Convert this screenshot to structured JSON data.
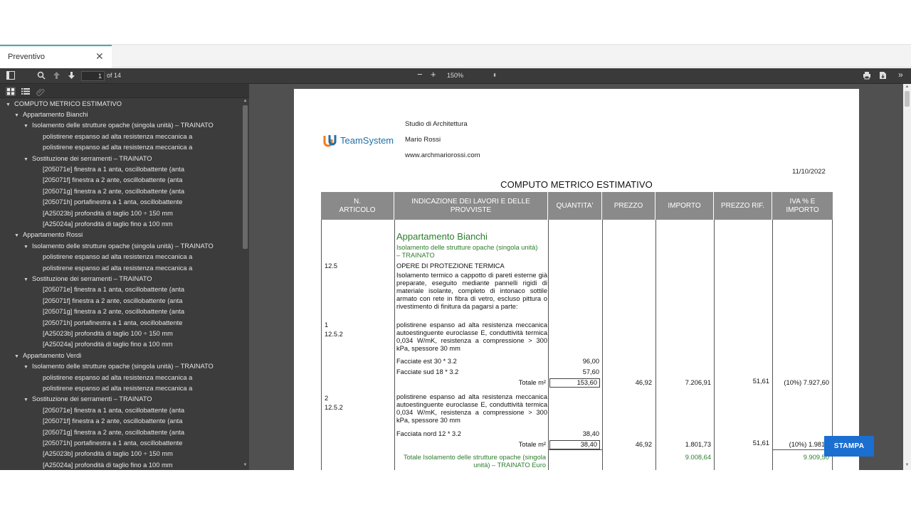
{
  "tab": {
    "label": "Preventivo",
    "close": "✕"
  },
  "toolbar": {
    "page_current": "1",
    "page_of": "of 14",
    "zoom_minus": "−",
    "zoom_plus": "+",
    "zoom_value": "150%"
  },
  "outline": {
    "root": "COMPUTO METRICO ESTIMATIVO",
    "rows": [
      {
        "level": 1,
        "toggle": "▼",
        "label": "Appartamento Bianchi"
      },
      {
        "level": 2,
        "toggle": "▼",
        "label": "Isolamento delle strutture opache (singola unità) – TRAINATO"
      },
      {
        "level": 3,
        "toggle": "",
        "label": "polistirene espanso ad alta resistenza meccanica a"
      },
      {
        "level": 3,
        "toggle": "",
        "label": "polistirene espanso ad alta resistenza meccanica a"
      },
      {
        "level": 2,
        "toggle": "▼",
        "label": "Sostituzione dei serramenti – TRAINATO"
      },
      {
        "level": 3,
        "toggle": "",
        "label": "[205071e] finestra a 1 anta, oscillobattente (anta"
      },
      {
        "level": 3,
        "toggle": "",
        "label": "[205071f] finestra a 2 ante, oscillobattente (anta"
      },
      {
        "level": 3,
        "toggle": "",
        "label": "[205071g] finestra a 2 ante, oscillobattente (anta"
      },
      {
        "level": 3,
        "toggle": "",
        "label": "[205071h] portafinestra a 1 anta, oscillobattente"
      },
      {
        "level": 3,
        "toggle": "",
        "label": "[A25023b] profondità di taglio 100 ÷ 150 mm"
      },
      {
        "level": 3,
        "toggle": "",
        "label": "[A25024a] profondità di taglio fino a 100 mm"
      },
      {
        "level": 1,
        "toggle": "▼",
        "label": "Appartamento Rossi"
      },
      {
        "level": 2,
        "toggle": "▼",
        "label": "Isolamento delle strutture opache (singola unità) – TRAINATO"
      },
      {
        "level": 3,
        "toggle": "",
        "label": "polistirene espanso ad alta resistenza meccanica a"
      },
      {
        "level": 3,
        "toggle": "",
        "label": "polistirene espanso ad alta resistenza meccanica a"
      },
      {
        "level": 2,
        "toggle": "▼",
        "label": "Sostituzione dei serramenti – TRAINATO"
      },
      {
        "level": 3,
        "toggle": "",
        "label": "[205071e] finestra a 1 anta, oscillobattente (anta"
      },
      {
        "level": 3,
        "toggle": "",
        "label": "[205071f] finestra a 2 ante, oscillobattente (anta"
      },
      {
        "level": 3,
        "toggle": "",
        "label": "[205071g] finestra a 2 ante, oscillobattente (anta"
      },
      {
        "level": 3,
        "toggle": "",
        "label": "[205071h] portafinestra a 1 anta, oscillobattente"
      },
      {
        "level": 3,
        "toggle": "",
        "label": "[A25023b] profondità di taglio 100 ÷ 150 mm"
      },
      {
        "level": 3,
        "toggle": "",
        "label": "[A25024a] profondità di taglio fino a 100 mm"
      },
      {
        "level": 1,
        "toggle": "▼",
        "label": "Appartamento Verdi"
      },
      {
        "level": 2,
        "toggle": "▼",
        "label": "Isolamento delle strutture opache (singola unità) – TRAINATO"
      },
      {
        "level": 3,
        "toggle": "",
        "label": "polistirene espanso ad alta resistenza meccanica a"
      },
      {
        "level": 3,
        "toggle": "",
        "label": "polistirene espanso ad alta resistenza meccanica a"
      },
      {
        "level": 2,
        "toggle": "▼",
        "label": "Sostituzione dei serramenti – TRAINATO"
      },
      {
        "level": 3,
        "toggle": "",
        "label": "[205071e] finestra a 1 anta, oscillobattente (anta"
      },
      {
        "level": 3,
        "toggle": "",
        "label": "[205071f] finestra a 2 ante, oscillobattente (anta"
      },
      {
        "level": 3,
        "toggle": "",
        "label": "[205071g] finestra a 2 ante, oscillobattente (anta"
      },
      {
        "level": 3,
        "toggle": "",
        "label": "[205071h] portafinestra a 1 anta, oscillobattente"
      },
      {
        "level": 3,
        "toggle": "",
        "label": "[A25023b] profondità di taglio 100 ÷ 150 mm"
      },
      {
        "level": 3,
        "toggle": "",
        "label": "[A25024a] profondità di taglio fino a 100 mm"
      }
    ]
  },
  "document": {
    "logo_text": "TeamSystem",
    "studio": "Studio di Architettura",
    "name": "Mario Rossi",
    "website": "www.archmariorossi.com",
    "date": "11/10/2022",
    "title": "COMPUTO METRICO ESTIMATIVO",
    "headers": {
      "articolo_1": "N.",
      "articolo_2": "ARTICOLO",
      "lavori_1": "INDICAZIONE DEI LAVORI E DELLE",
      "lavori_2": "PROVVISTE",
      "quantita": "QUANTITA'",
      "prezzo": "PREZZO",
      "importo": "IMPORTO",
      "prezzo_rif": "PREZZO RIF.",
      "iva_1": "IVA % E",
      "iva_2": "IMPORTO"
    },
    "section_title": "Appartamento Bianchi",
    "subsection_1": "Isolamento delle strutture opache (singola unità)",
    "subsection_2": "– TRAINATO",
    "code_12_5": "12.5",
    "opere": "OPERE DI PROTEZIONE TERMICA",
    "opere_desc": "Isolamento termico a cappotto di pareti esterne già preparate, eseguito mediante pannelli rigidi di materiale isolante, completo di intonaco sottile armato con rete in fibra di vetro, escluso pittura o rivestimento di finitura da pagarsi a parte:",
    "item1": {
      "n": "1",
      "code": "12.5.2",
      "desc": "polistirene espanso ad alta resistenza meccanica autoestinguente euroclasse E, conduttività termica 0,034 W/mK, resistenza a compressione > 300 kPa, spessore 30 mm",
      "m1_label": "Facciate est 30 * 3.2",
      "m1_value": "96,00",
      "m2_label": "Facciate sud 18 * 3.2",
      "m2_value": "57,60",
      "total_label": "Totale m²",
      "total_qty": "153,60",
      "price": "46,92",
      "amount": "7.206,91",
      "ref_price": "51,61",
      "iva": "(10%) 7.927,60"
    },
    "item2": {
      "n": "2",
      "code": "12.5.2",
      "desc": "polistirene espanso ad alta resistenza meccanica autoestinguente euroclasse E, conduttività termica 0,034 W/mK, resistenza a compressione > 300 kPa, spessore 30 mm",
      "m1_label": "Facciata nord 12 * 3.2",
      "m1_value": "38,40",
      "total_label": "Totale m²",
      "total_qty": "38,40",
      "price": "46,92",
      "amount": "1.801,73",
      "ref_price": "51,61",
      "iva": "(10%) 1.981,9"
    },
    "subtotal_label_1": "Totale Isolamento delle strutture opache (singola",
    "subtotal_label_2": "unità) – TRAINATO Euro",
    "subtotal_amount": "9.008,64",
    "subtotal_iva": "9.909,50"
  },
  "stampa_label": "STAMPA",
  "colors": {
    "accent": "#1b6fd1",
    "tab_accent": "#3fb3b3",
    "green_text": "#2b7d2b",
    "header_bg": "#8a8a8a"
  }
}
